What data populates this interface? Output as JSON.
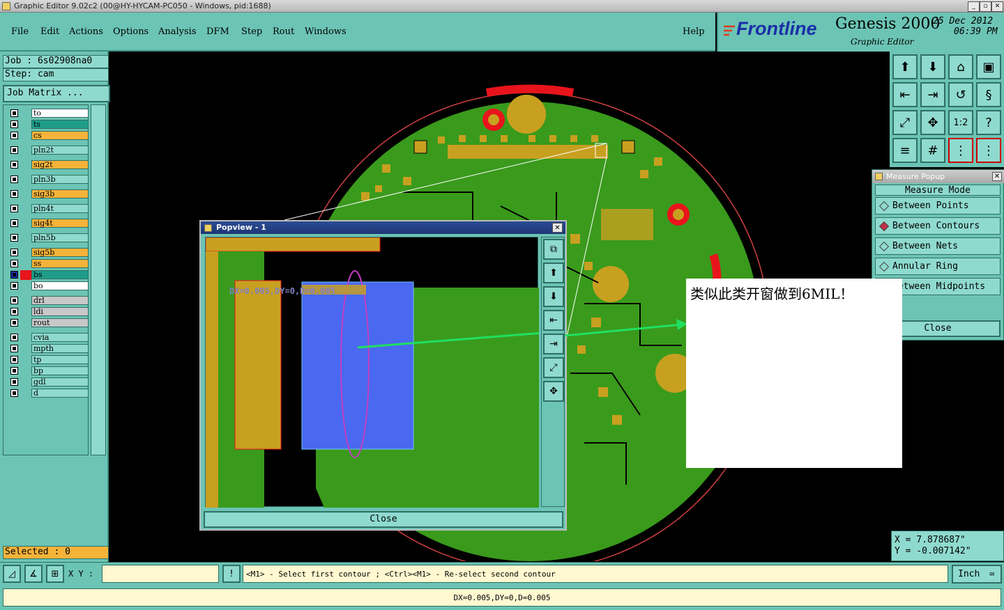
{
  "window": {
    "title": "Graphic Editor 9.02c2 (00@HY-HYCAM-PC050 - Windows, pid:1688)"
  },
  "menu": [
    "File",
    "Edit",
    "Actions",
    "Options",
    "Analysis",
    "DFM",
    "Step",
    "Rout",
    "Windows"
  ],
  "help_label": "Help",
  "brand": {
    "logo": "Frontline",
    "product": "Genesis 2000",
    "subtitle": "Graphic Editor",
    "date": "25 Dec 2012",
    "time": "06:39 PM"
  },
  "job": {
    "job_label": "Job : 6s02908na0",
    "step_label": "Step: cam",
    "matrix_button": "Job Matrix ..."
  },
  "layers": [
    {
      "name": "to",
      "color": "#ffffff"
    },
    {
      "name": "ts",
      "color": "#1e9e8a"
    },
    {
      "name": "cs",
      "color": "#f5b33a"
    },
    {
      "name": "pln2t",
      "color": "#8fdace"
    },
    {
      "name": "sig2t",
      "color": "#f5b33a"
    },
    {
      "name": "pln3b",
      "color": "#8fdace"
    },
    {
      "name": "sig3b",
      "color": "#f5b33a"
    },
    {
      "name": "pln4t",
      "color": "#8fdace"
    },
    {
      "name": "sig4t",
      "color": "#f5b33a"
    },
    {
      "name": "pln5b",
      "color": "#8fdace"
    },
    {
      "name": "sig5b",
      "color": "#f5b33a"
    },
    {
      "name": "ss",
      "color": "#f5b33a"
    },
    {
      "name": "bs",
      "color": "#1e9e8a"
    },
    {
      "name": "bo",
      "color": "#ffffff"
    },
    {
      "name": "drl",
      "color": "#c8c8c8"
    },
    {
      "name": "ldi",
      "color": "#c8c8c8"
    },
    {
      "name": "rout",
      "color": "#c8c8c8"
    },
    {
      "name": "cvia",
      "color": "#8fdace"
    },
    {
      "name": "mpth",
      "color": "#8fdace"
    },
    {
      "name": "tp",
      "color": "#8fdace"
    },
    {
      "name": "bp",
      "color": "#8fdace"
    },
    {
      "name": "gdl",
      "color": "#8fdace"
    },
    {
      "name": "d",
      "color": "#8fdace"
    }
  ],
  "selected_label": "Selected : 0",
  "measure": {
    "title": "Measure Popup",
    "mode_label": "Measure Mode",
    "options": [
      "Between Points",
      "Between Contours",
      "Between Nets",
      "Annular Ring",
      "Between Midpoints"
    ],
    "selected": "Between Contours",
    "close_label": "Close"
  },
  "popview": {
    "title": "Popview - 1",
    "measure_text": "DX=0.005,DY=0,D=0.005",
    "close_label": "Close"
  },
  "annotation": {
    "text": "类似此类开窗做到6MIL！"
  },
  "coords": {
    "x": "X = 7.878687\"",
    "y": "Y = -0.007142\""
  },
  "bottom": {
    "xy_label": "X Y :",
    "xy_value": "",
    "prompt": "<M1> - Select first contour ; <Ctrl><M1> - Re-select second contour",
    "unit": "Inch",
    "status": "DX=0.005,DY=0,D=0.005"
  }
}
